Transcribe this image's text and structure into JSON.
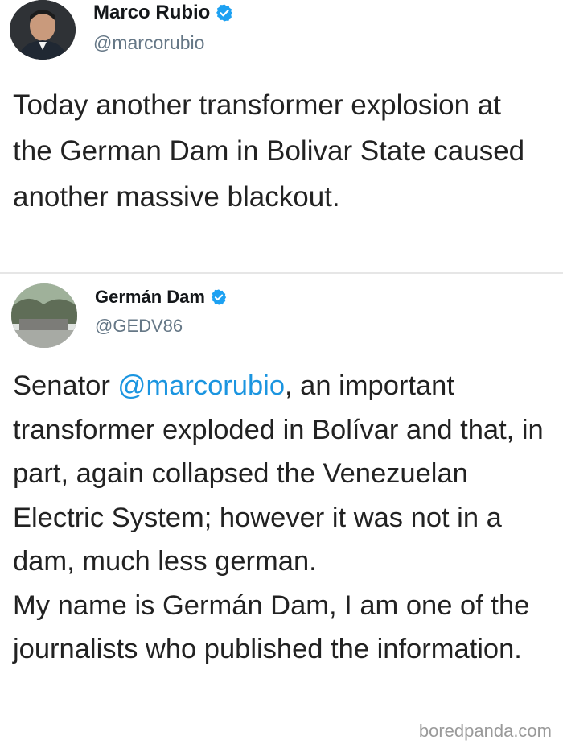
{
  "tweet1": {
    "name": "Marco Rubio",
    "handle": "@marcorubio",
    "text": "Today another transformer explosion at the German Dam in Bolivar State caused another massive blackout."
  },
  "tweet2": {
    "name": "Germán Dam",
    "handle": "@GEDV86",
    "text_prefix": "Senator ",
    "mention": "@marcorubio",
    "text_rest": ", an important transformer exploded in Bolívar and that, in part, again collapsed the Venezuelan Electric System; however it was not in a dam, much less german.",
    "text_para2": "My name is Germán Dam, I am one of the journalists who published the information."
  },
  "watermark": "boredpanda.com",
  "colors": {
    "verified": "#1da1f2",
    "mention": "#1b95e0",
    "handle": "#657786"
  },
  "icons": [
    "verified-badge-icon",
    "avatar"
  ]
}
